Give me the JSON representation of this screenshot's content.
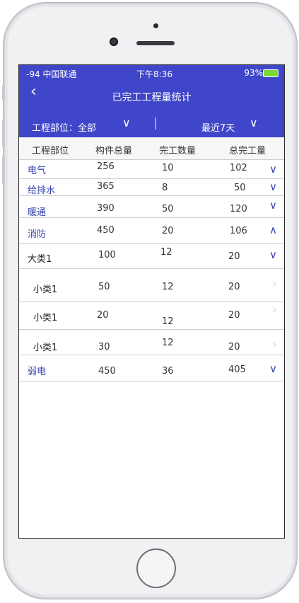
{
  "status_bar": {
    "carrier": "-94 中国联通",
    "time": "下午8:36",
    "battery": "93%"
  },
  "nav": {
    "back_icon": "chevron-left-icon",
    "title": "已完工工程量统计"
  },
  "filters": {
    "department_label": "工程部位：全部",
    "range_label": "最近7天"
  },
  "table": {
    "headers": [
      "工程部位",
      "构件总量",
      "完工数量",
      "总完工量"
    ],
    "rows": [
      {
        "name": "电气",
        "total": "256",
        "done": "10",
        "overall": "102",
        "chev": "∨"
      },
      {
        "name": "给排水",
        "total": "365",
        "done": "8",
        "overall": "50",
        "chev": "∨"
      },
      {
        "name": "暖通",
        "total": "390",
        "done": "50",
        "overall": "120",
        "chev": "∨"
      },
      {
        "name": "消防",
        "total": "450",
        "done": "20",
        "overall": "106",
        "chev": "∧"
      },
      {
        "name": "大类1",
        "total": "100",
        "done": "12",
        "overall": "20",
        "chev": "∨"
      },
      {
        "name": "小类1",
        "total": "50",
        "done": "12",
        "overall": "20",
        "chev": "›"
      },
      {
        "name": "小类1",
        "total": "20",
        "done": "12",
        "overall": "20",
        "chev": "›"
      },
      {
        "name": "小类1",
        "total": "30",
        "done": "12",
        "overall": "20",
        "chev": "›"
      },
      {
        "name": "弱电",
        "total": "450",
        "done": "36",
        "overall": "405",
        "chev": "∨"
      }
    ]
  },
  "colors": {
    "header_bg": "#3f46c9",
    "accent": "#3a45b0"
  }
}
